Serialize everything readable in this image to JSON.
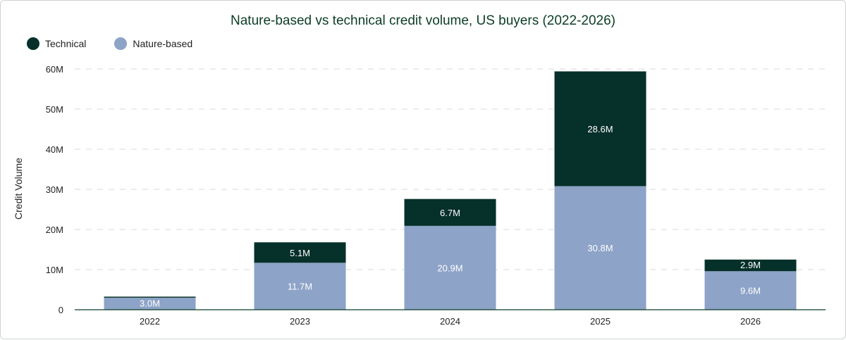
{
  "chart_data": {
    "type": "bar",
    "stacked": true,
    "title": "Nature-based vs technical credit volume, US buyers (2022-2026)",
    "ylabel": "Credit Volume",
    "xlabel": "",
    "categories": [
      "2022",
      "2023",
      "2024",
      "2025",
      "2026"
    ],
    "ylim": [
      0,
      60
    ],
    "yticks": [
      0,
      10,
      20,
      30,
      40,
      50,
      60
    ],
    "ytick_labels": [
      "0",
      "10M",
      "20M",
      "30M",
      "40M",
      "50M",
      "60M"
    ],
    "grid": true,
    "legend_position": "top-left",
    "series": [
      {
        "name": "Nature-based",
        "color": "#8da3c7",
        "label_color": "#ffffff",
        "values": [
          3.0,
          11.7,
          20.9,
          30.8,
          9.6
        ],
        "labels": [
          "3.0M",
          "11.7M",
          "20.9M",
          "30.8M",
          "9.6M"
        ]
      },
      {
        "name": "Technical",
        "color": "#06302a",
        "label_color": "#ffffff",
        "values": [
          0.2,
          5.1,
          6.7,
          28.6,
          2.9
        ],
        "labels": [
          "",
          "5.1M",
          "6.7M",
          "28.6M",
          "2.9M"
        ]
      }
    ],
    "legend_order": [
      "Technical",
      "Nature-based"
    ]
  }
}
